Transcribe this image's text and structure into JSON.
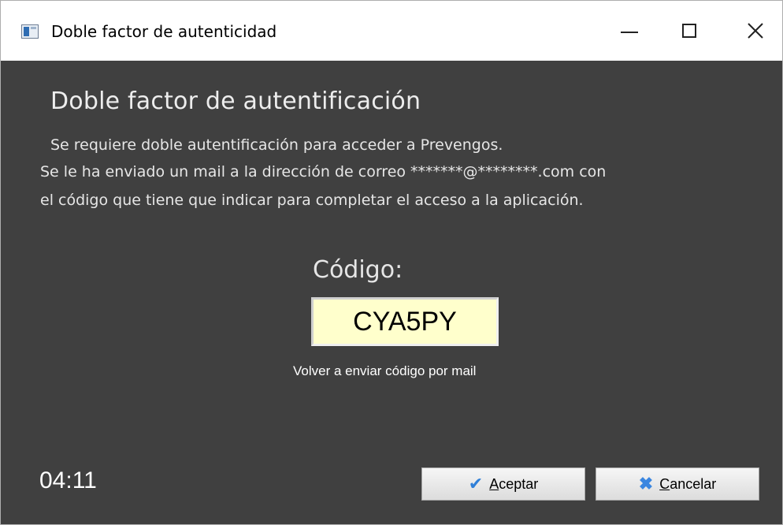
{
  "window": {
    "title": "Doble factor de autenticidad",
    "icon": "app-window-icon",
    "controls": {
      "minimize": "minimize-icon",
      "maximize": "maximize-icon",
      "close": "close-icon"
    }
  },
  "content": {
    "heading": "Doble factor de autentificación",
    "paragraph_1": "Se requiere doble autentificación para acceder a Prevengos.",
    "paragraph_2": "Se le ha enviado un mail a la dirección de correo *******@********.com con",
    "paragraph_3": "el código que tiene que indicar para completar el acceso a la aplicación.",
    "code_label": "Código:",
    "code_value": "CYA5PY",
    "resend_link": "Volver a enviar código por mail",
    "timer": "04:11"
  },
  "buttons": {
    "accept": {
      "accel": "A",
      "rest": "ceptar",
      "icon": "check-icon"
    },
    "cancel": {
      "accel": "C",
      "rest": "ancelar",
      "icon": "x-icon"
    }
  },
  "colors": {
    "background": "#404040",
    "input_background": "#ffffcc",
    "accent_icon": "#2f7fd8"
  }
}
